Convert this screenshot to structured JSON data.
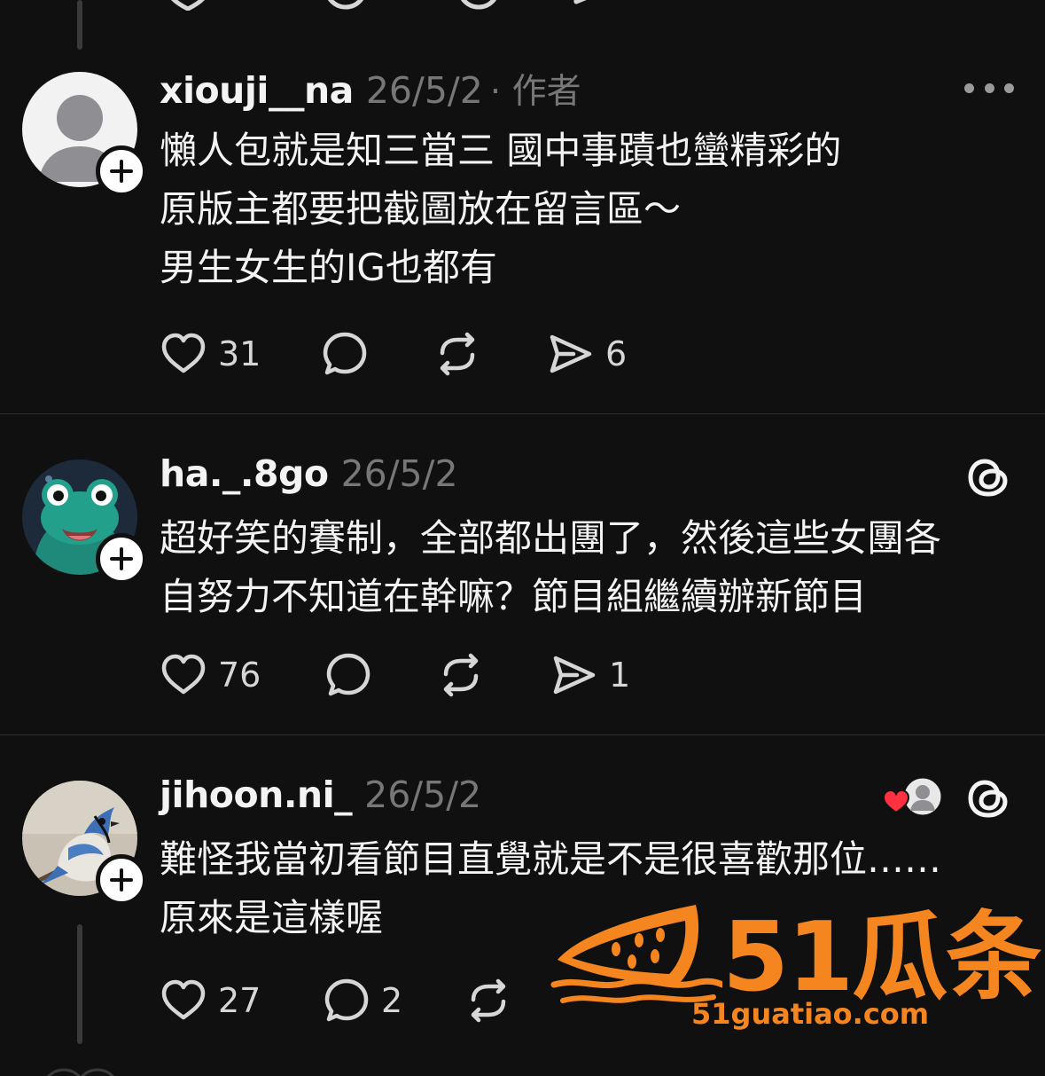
{
  "posts": [
    {
      "username": "xiouji__na",
      "date": "26/5/2",
      "author_tag": "· 作者",
      "lines": [
        "懶人包就是知三當三 國中事蹟也蠻精彩的",
        "原版主都要把截圖放在留言區～",
        "男生女生的IG也都有"
      ],
      "likes": "31",
      "replies": "",
      "shares": "6"
    },
    {
      "username": "ha._.8go",
      "date": "26/5/2",
      "lines": [
        "超好笑的賽制，全部都出團了，然後這些女團各",
        "自努力不知道在幹嘛？節目組繼續辦新節目"
      ],
      "likes": "76",
      "replies": "",
      "shares": "1"
    },
    {
      "username": "jihoon.ni_",
      "date": "26/5/2",
      "lines": [
        "難怪我當初看節目直覺就是不是很喜歡那位……",
        "原來是這樣喔"
      ],
      "likes": "27",
      "replies": "2",
      "shares": ""
    }
  ],
  "watermark": {
    "brand": "51瓜条",
    "url": "51guatiao.com"
  },
  "colors": {
    "background": "#101010",
    "text": "#f3f3f3",
    "muted": "#777777",
    "like_heart": "#ff3040",
    "watermark": "#f5861f"
  },
  "icons": [
    "heart-icon",
    "comment-icon",
    "repost-icon",
    "share-icon",
    "more-icon",
    "threads-logo-icon",
    "plus-icon"
  ]
}
